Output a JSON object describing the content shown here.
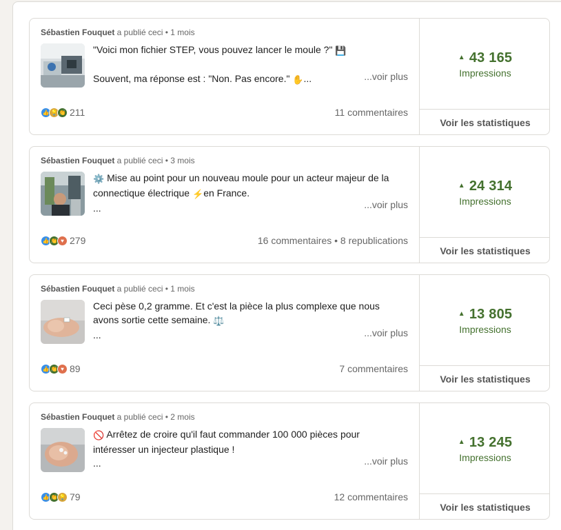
{
  "posts": [
    {
      "author": "Sébastien Fouquet",
      "action": " a publié ceci • ",
      "age": "1 mois",
      "line1": "\"Voici mon fichier STEP, vous pouvez lancer le moule ?\"",
      "line1_emoji": "💾",
      "line2": "Souvent, ma réponse est : \"Non. Pas encore.\"",
      "line2_emoji": "✋",
      "line2_suffix": "...",
      "line3": "",
      "more": "...voir plus",
      "reactions_icons": [
        "like-icon",
        "support-icon",
        "celebrate-icon"
      ],
      "reactions_count": "211",
      "comments": "11 commentaires",
      "impressions": "43 165",
      "impressions_label": "Impressions",
      "stats_label": "Voir les statistiques"
    },
    {
      "author": "Sébastien Fouquet",
      "action": " a publié ceci • ",
      "age": "3 mois",
      "line1_emoji": "⚙️",
      "line1": "Mise au point pour un nouveau moule pour un acteur majeur de la",
      "line2": "connectique électrique",
      "line2_emoji": "⚡",
      "line2_suffix": "en France.",
      "line3": "...",
      "more": "...voir plus",
      "reactions_icons": [
        "like-icon",
        "celebrate-icon",
        "love-icon"
      ],
      "reactions_count": "279",
      "comments": "16 commentaires • 8 republications",
      "impressions": "24 314",
      "impressions_label": "Impressions",
      "stats_label": "Voir les statistiques"
    },
    {
      "author": "Sébastien Fouquet",
      "action": " a publié ceci • ",
      "age": "1 mois",
      "line1": "Ceci pèse 0,2 gramme. Et c'est la pièce la plus complexe que nous",
      "line2": "avons sortie cette semaine.",
      "line2_emoji": "⚖️",
      "line2_suffix": "",
      "line3": "...",
      "more": "...voir plus",
      "reactions_icons": [
        "like-icon",
        "celebrate-icon",
        "love-icon"
      ],
      "reactions_count": "89",
      "comments": "7 commentaires",
      "impressions": "13 805",
      "impressions_label": "Impressions",
      "stats_label": "Voir les statistiques"
    },
    {
      "author": "Sébastien Fouquet",
      "action": " a publié ceci • ",
      "age": "2 mois",
      "line1_emoji": "🚫",
      "line1": "Arrêtez de croire qu'il faut commander 100 000 pièces pour",
      "line2": "intéresser un injecteur plastique !",
      "line2_suffix": "",
      "line3": "...",
      "more": "...voir plus",
      "reactions_icons": [
        "like-icon",
        "celebrate-icon",
        "support-icon"
      ],
      "reactions_count": "79",
      "comments": "12 commentaires",
      "impressions": "13 245",
      "impressions_label": "Impressions",
      "stats_label": "Voir les statistiques"
    }
  ]
}
